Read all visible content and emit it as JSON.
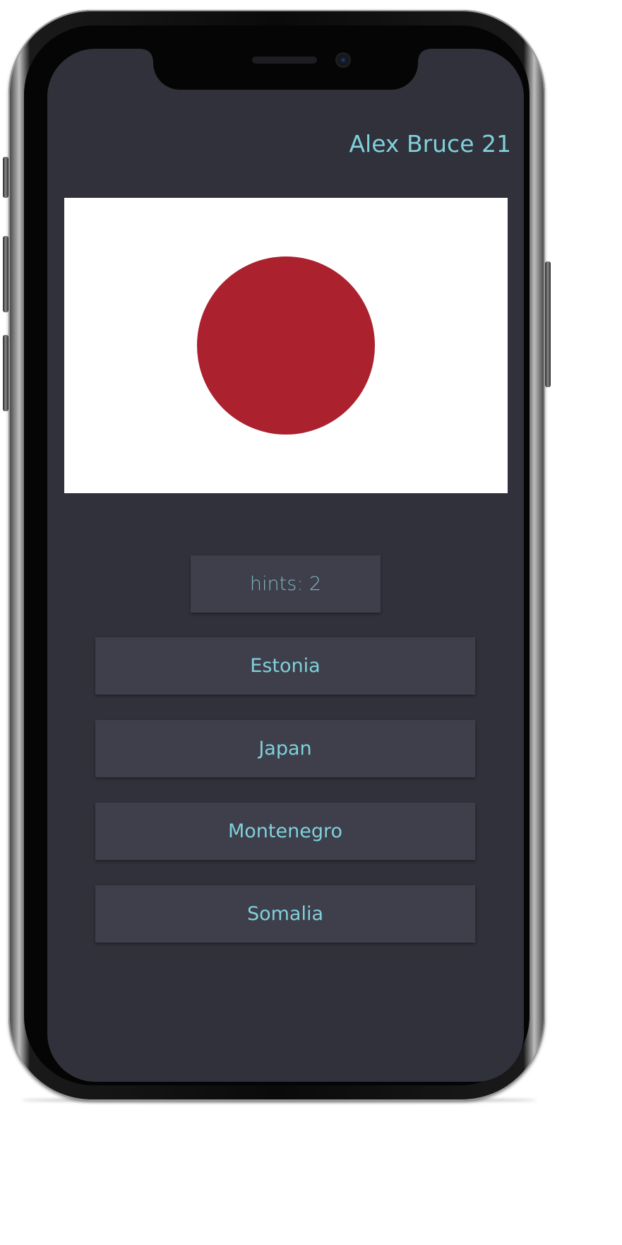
{
  "header": {
    "username": "Alex Bruce 21"
  },
  "flag": {
    "country_hint": "japan-flag",
    "background_color": "#ffffff",
    "disc_color": "#ab222e"
  },
  "hints": {
    "label": "hints: 2"
  },
  "answers": [
    {
      "label": "Estonia"
    },
    {
      "label": "Japan"
    },
    {
      "label": "Montenegro"
    },
    {
      "label": "Somalia"
    }
  ],
  "colors": {
    "screen_bg": "#30313a",
    "button_bg": "#3e3f4a",
    "accent_text": "#7fd0dc"
  }
}
